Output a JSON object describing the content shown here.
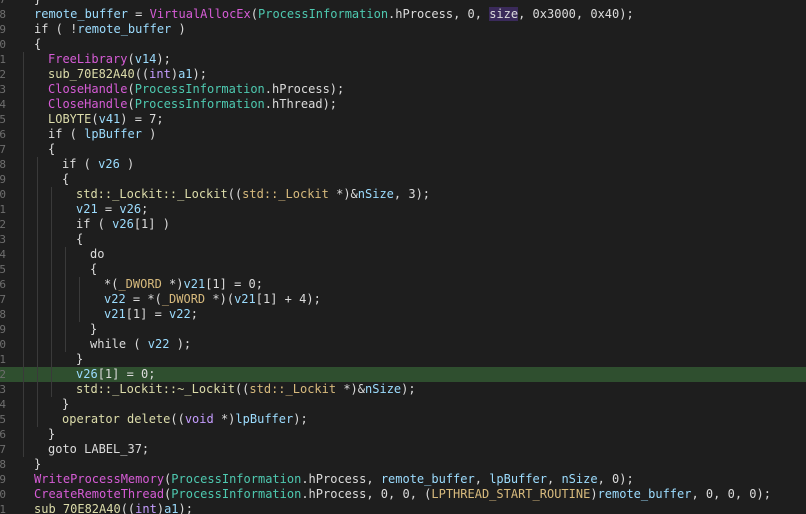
{
  "colors": {
    "background": "#1e1e1e",
    "current_line": "#2f4f2f",
    "line_number": "#6e6e6e",
    "function": "#dcdcaa",
    "api_call": "#d65cd6",
    "variable": "#9cdcfe",
    "global": "#d7ba7d",
    "type": "#c59dff",
    "member": "#4ec9b0",
    "default": "#dcdcdc"
  },
  "highlighted_line_index": 25,
  "lines": [
    {
      "num": "7",
      "indent": 1,
      "tokens": [
        [
          "}",
          "punc"
        ]
      ]
    },
    {
      "num": "8",
      "indent": 1,
      "tokens": [
        [
          "remote_buffer",
          "var"
        ],
        [
          " = ",
          "punc"
        ],
        [
          "VirtualAllocEx",
          "api"
        ],
        [
          "(",
          "punc"
        ],
        [
          "ProcessInformation",
          "obj"
        ],
        [
          ".hProcess, 0, ",
          "punc"
        ],
        [
          "size",
          "sel"
        ],
        [
          ", 0x3000, 0x40);",
          "punc"
        ]
      ]
    },
    {
      "num": "9",
      "indent": 1,
      "tokens": [
        [
          "if ( !",
          "punc"
        ],
        [
          "remote_buffer",
          "var"
        ],
        [
          " )",
          "punc"
        ]
      ]
    },
    {
      "num": "0",
      "indent": 1,
      "tokens": [
        [
          "{",
          "punc"
        ]
      ]
    },
    {
      "num": "1",
      "indent": 2,
      "tokens": [
        [
          "FreeLibrary",
          "api"
        ],
        [
          "(",
          "punc"
        ],
        [
          "v14",
          "var"
        ],
        [
          ");",
          "punc"
        ]
      ]
    },
    {
      "num": "2",
      "indent": 2,
      "tokens": [
        [
          "sub_70E82A40",
          "fn"
        ],
        [
          "((",
          "punc"
        ],
        [
          "int",
          "type"
        ],
        [
          ")",
          "punc"
        ],
        [
          "a1",
          "var"
        ],
        [
          ");",
          "punc"
        ]
      ]
    },
    {
      "num": "3",
      "indent": 2,
      "tokens": [
        [
          "CloseHandle",
          "api"
        ],
        [
          "(",
          "punc"
        ],
        [
          "ProcessInformation",
          "obj"
        ],
        [
          ".hProcess);",
          "punc"
        ]
      ]
    },
    {
      "num": "4",
      "indent": 2,
      "tokens": [
        [
          "CloseHandle",
          "api"
        ],
        [
          "(",
          "punc"
        ],
        [
          "ProcessInformation",
          "obj"
        ],
        [
          ".hThread);",
          "punc"
        ]
      ]
    },
    {
      "num": "5",
      "indent": 2,
      "tokens": [
        [
          "LOBYTE",
          "fn"
        ],
        [
          "(",
          "punc"
        ],
        [
          "v41",
          "var"
        ],
        [
          ") = 7;",
          "punc"
        ]
      ]
    },
    {
      "num": "6",
      "indent": 2,
      "tokens": [
        [
          "if ( ",
          "punc"
        ],
        [
          "lpBuffer",
          "var"
        ],
        [
          " )",
          "punc"
        ]
      ]
    },
    {
      "num": "7",
      "indent": 2,
      "tokens": [
        [
          "{",
          "punc"
        ]
      ]
    },
    {
      "num": "8",
      "indent": 3,
      "tokens": [
        [
          "if ( ",
          "punc"
        ],
        [
          "v26",
          "var"
        ],
        [
          " )",
          "punc"
        ]
      ]
    },
    {
      "num": "9",
      "indent": 3,
      "tokens": [
        [
          "{",
          "punc"
        ]
      ]
    },
    {
      "num": "0",
      "indent": 4,
      "tokens": [
        [
          "std::_Lockit::_Lockit",
          "fn"
        ],
        [
          "((",
          "punc"
        ],
        [
          "std::_Lockit",
          "glob"
        ],
        [
          " *)&",
          "punc"
        ],
        [
          "nSize",
          "var"
        ],
        [
          ", 3);",
          "punc"
        ]
      ]
    },
    {
      "num": "1",
      "indent": 4,
      "tokens": [
        [
          "v21",
          "var"
        ],
        [
          " = ",
          "punc"
        ],
        [
          "v26",
          "var"
        ],
        [
          ";",
          "punc"
        ]
      ]
    },
    {
      "num": "2",
      "indent": 4,
      "tokens": [
        [
          "if ( ",
          "punc"
        ],
        [
          "v26",
          "var"
        ],
        [
          "[1] )",
          "punc"
        ]
      ]
    },
    {
      "num": "3",
      "indent": 4,
      "tokens": [
        [
          "{",
          "punc"
        ]
      ]
    },
    {
      "num": "4",
      "indent": 5,
      "tokens": [
        [
          "do",
          "punc"
        ]
      ]
    },
    {
      "num": "5",
      "indent": 5,
      "tokens": [
        [
          "{",
          "punc"
        ]
      ]
    },
    {
      "num": "6",
      "indent": 6,
      "tokens": [
        [
          "*(",
          "punc"
        ],
        [
          "_DWORD",
          "glob"
        ],
        [
          " *)",
          "punc"
        ],
        [
          "v21",
          "var"
        ],
        [
          "[1] = 0;",
          "punc"
        ]
      ]
    },
    {
      "num": "7",
      "indent": 6,
      "tokens": [
        [
          "v22",
          "var"
        ],
        [
          " = *(",
          "punc"
        ],
        [
          "_DWORD",
          "glob"
        ],
        [
          " *)(",
          "punc"
        ],
        [
          "v21",
          "var"
        ],
        [
          "[1] + 4);",
          "punc"
        ]
      ]
    },
    {
      "num": "8",
      "indent": 6,
      "tokens": [
        [
          "v21",
          "var"
        ],
        [
          "[1] = ",
          "punc"
        ],
        [
          "v22",
          "var"
        ],
        [
          ";",
          "punc"
        ]
      ]
    },
    {
      "num": "9",
      "indent": 5,
      "tokens": [
        [
          "}",
          "punc"
        ]
      ]
    },
    {
      "num": "0",
      "indent": 5,
      "tokens": [
        [
          "while ( ",
          "punc"
        ],
        [
          "v22",
          "var"
        ],
        [
          " );",
          "punc"
        ]
      ]
    },
    {
      "num": "1",
      "indent": 4,
      "tokens": [
        [
          "}",
          "punc"
        ]
      ]
    },
    {
      "num": "2",
      "indent": 4,
      "tokens": [
        [
          "v26",
          "var"
        ],
        [
          "[1] = 0;",
          "punc"
        ]
      ]
    },
    {
      "num": "3",
      "indent": 4,
      "tokens": [
        [
          "std::_Lockit::~_Lockit",
          "fn"
        ],
        [
          "((",
          "punc"
        ],
        [
          "std::_Lockit",
          "glob"
        ],
        [
          " *)&",
          "punc"
        ],
        [
          "nSize",
          "var"
        ],
        [
          ");",
          "punc"
        ]
      ]
    },
    {
      "num": "4",
      "indent": 3,
      "tokens": [
        [
          "}",
          "punc"
        ]
      ]
    },
    {
      "num": "5",
      "indent": 3,
      "tokens": [
        [
          "operator delete",
          "fn"
        ],
        [
          "((",
          "punc"
        ],
        [
          "void",
          "type"
        ],
        [
          " *)",
          "punc"
        ],
        [
          "lpBuffer",
          "var"
        ],
        [
          ");",
          "punc"
        ]
      ]
    },
    {
      "num": "6",
      "indent": 2,
      "tokens": [
        [
          "}",
          "punc"
        ]
      ]
    },
    {
      "num": "7",
      "indent": 2,
      "tokens": [
        [
          "goto LABEL_37;",
          "punc"
        ]
      ]
    },
    {
      "num": "8",
      "indent": 1,
      "tokens": [
        [
          "}",
          "punc"
        ]
      ]
    },
    {
      "num": "9",
      "indent": 1,
      "tokens": [
        [
          "WriteProcessMemory",
          "api"
        ],
        [
          "(",
          "punc"
        ],
        [
          "ProcessInformation",
          "obj"
        ],
        [
          ".hProcess, ",
          "punc"
        ],
        [
          "remote_buffer",
          "var"
        ],
        [
          ", ",
          "punc"
        ],
        [
          "lpBuffer",
          "var"
        ],
        [
          ", ",
          "punc"
        ],
        [
          "nSize",
          "var"
        ],
        [
          ", 0);",
          "punc"
        ]
      ]
    },
    {
      "num": "0",
      "indent": 1,
      "tokens": [
        [
          "CreateRemoteThread",
          "api"
        ],
        [
          "(",
          "punc"
        ],
        [
          "ProcessInformation",
          "obj"
        ],
        [
          ".hProcess, 0, 0, (",
          "punc"
        ],
        [
          "LPTHREAD_START_ROUTINE",
          "glob"
        ],
        [
          ")",
          "punc"
        ],
        [
          "remote_buffer",
          "var"
        ],
        [
          ", 0, 0, 0);",
          "punc"
        ]
      ]
    },
    {
      "num": "1",
      "indent": 1,
      "tokens": [
        [
          "sub_70E82A40",
          "fn"
        ],
        [
          "((",
          "punc"
        ],
        [
          "int",
          "type"
        ],
        [
          ")",
          "punc"
        ],
        [
          "a1",
          "var"
        ],
        [
          ");",
          "punc"
        ]
      ]
    }
  ]
}
